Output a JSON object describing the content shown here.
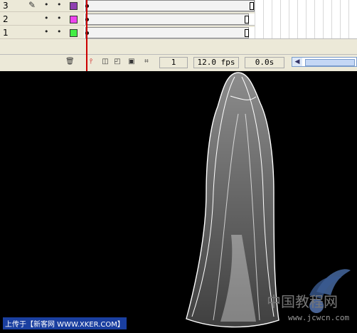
{
  "timeline": {
    "layers": [
      {
        "number": "3",
        "swatch_color": "#9040b0",
        "editing": true
      },
      {
        "number": "2",
        "swatch_color": "#ee44ee",
        "editing": false
      },
      {
        "number": "1",
        "swatch_color": "#44ee44",
        "editing": false
      }
    ],
    "icons": {
      "trash": "trash-icon",
      "add_motion_guide": "add-motion-guide-icon",
      "onion_skin": "onion-skin-icon",
      "onion_outlines": "onion-outlines-icon",
      "edit_multiple": "edit-multiple-frames-icon",
      "modify_markers": "modify-onion-markers-icon"
    },
    "current_frame": "1",
    "frame_rate": "12.0 fps",
    "elapsed_time": "0.0s",
    "playhead_color": "#cc0000"
  },
  "watermark": {
    "text": "上传于【新客网 WWW.XKER.COM】"
  },
  "logo": {
    "chinese": "中国教程网",
    "url": "www.jcwcn.com"
  }
}
